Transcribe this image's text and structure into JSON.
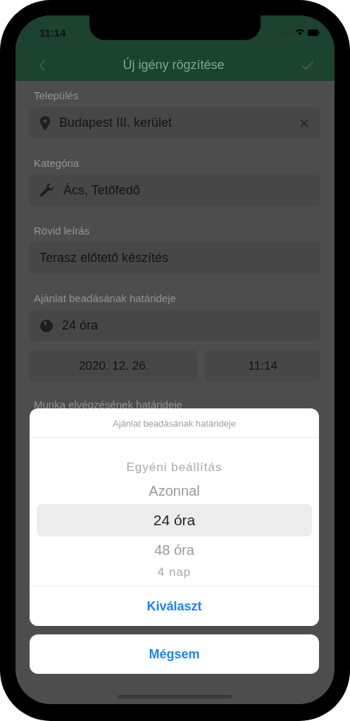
{
  "status_bar": {
    "time": "11:14"
  },
  "nav": {
    "title": "Új igény rögzítése"
  },
  "form": [
    {
      "label": "Település",
      "kind": "location",
      "value": "Budapest III. kerület",
      "clearable": true
    },
    {
      "label": "Kategória",
      "kind": "category",
      "value": "Ács, Tetőfedő",
      "clearable": false
    },
    {
      "label": "Rövid leírás",
      "kind": "text",
      "value": "Terasz előtető készítés",
      "clearable": false
    },
    {
      "label": "Ajánlat beadásának határideje",
      "kind": "deadline",
      "value": "24 óra",
      "clearable": false
    }
  ],
  "date_row": {
    "date": "2020. 12. 26.",
    "time": "11:14"
  },
  "next_label": "Munka elvégzésének határideje",
  "sheet": {
    "title": "Ajánlat beadásának határideje",
    "options": [
      {
        "label": "Egyéni beállítás",
        "selected": false
      },
      {
        "label": "Azonnal",
        "selected": false
      },
      {
        "label": "24 óra",
        "selected": true
      },
      {
        "label": "48 óra",
        "selected": false
      },
      {
        "label": "4 nap",
        "selected": false
      }
    ],
    "confirm": "Kiválaszt",
    "cancel": "Mégsem"
  }
}
